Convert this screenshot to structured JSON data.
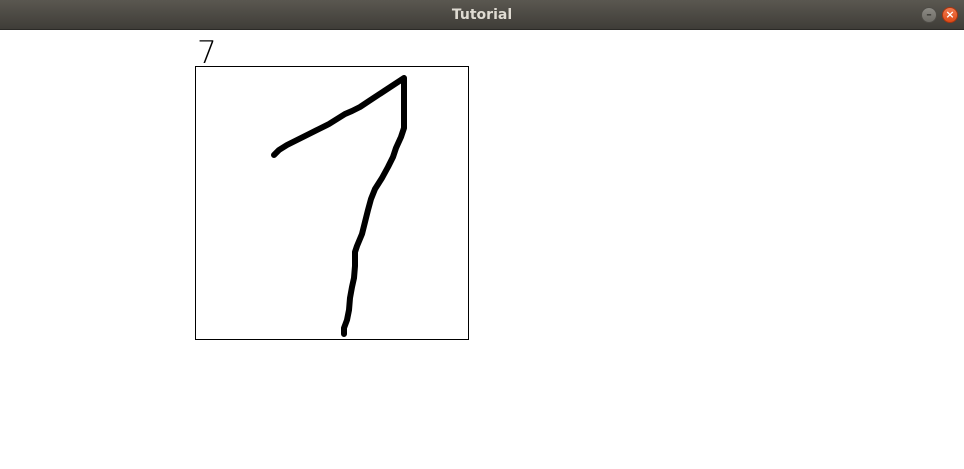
{
  "window": {
    "title": "Tutorial",
    "minimize_glyph": "–",
    "close_glyph": "×"
  },
  "prediction": {
    "digit": "7"
  },
  "canvas": {
    "stroke_color": "#000000",
    "background_color": "#ffffff"
  }
}
